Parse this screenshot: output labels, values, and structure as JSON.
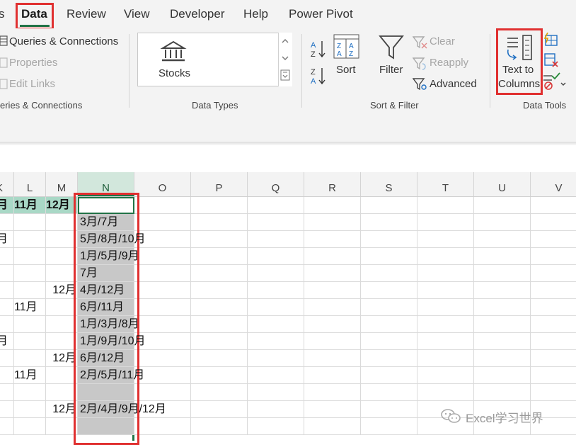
{
  "tabs": [
    "s",
    "Data",
    "Review",
    "View",
    "Developer",
    "Help",
    "Power Pivot"
  ],
  "queries": {
    "items": [
      "Queries & Connections",
      "Properties",
      "Edit Links"
    ],
    "group_label": "eries & Connections"
  },
  "data_types": {
    "stocks_label": "Stocks",
    "group_label": "Data Types"
  },
  "sort_filter": {
    "sort_label": "Sort",
    "filter_label": "Filter",
    "clear_label": "Clear",
    "reapply_label": "Reapply",
    "advanced_label": "Advanced",
    "group_label": "Sort & Filter"
  },
  "data_tools": {
    "text_to_columns_line1": "Text to",
    "text_to_columns_line2": "Columns",
    "group_label": "Data Tools"
  },
  "columns": [
    "K",
    "L",
    "M",
    "N",
    "O",
    "P",
    "Q",
    "R",
    "S",
    "T",
    "U",
    "V"
  ],
  "grid": {
    "header_row": {
      "K": "月",
      "L": "11月",
      "M": "12月",
      "N": ""
    },
    "rows": [
      {
        "K": "",
        "L": "",
        "M": "",
        "N": "3月/7月"
      },
      {
        "K": "月",
        "L": "",
        "M": "",
        "N": "5月/8月/10月"
      },
      {
        "K": "",
        "L": "",
        "M": "",
        "N": "1月/5月/9月"
      },
      {
        "K": "",
        "L": "",
        "M": "",
        "N": "7月"
      },
      {
        "K": "",
        "L": "",
        "M": "12月",
        "N": "4月/12月"
      },
      {
        "K": "",
        "L": "11月",
        "M": "",
        "N": "6月/11月"
      },
      {
        "K": "",
        "L": "",
        "M": "",
        "N": "1月/3月/8月"
      },
      {
        "K": "月",
        "L": "",
        "M": "",
        "N": "1月/9月/10月"
      },
      {
        "K": "",
        "L": "",
        "M": "12月",
        "N": "6月/12月"
      },
      {
        "K": "",
        "L": "11月",
        "M": "",
        "N": "2月/5月/11月"
      },
      {
        "K": "",
        "L": "",
        "M": "",
        "N": ""
      },
      {
        "K": "",
        "L": "",
        "M": "12月",
        "N": "2月/4月/9月/12月"
      },
      {
        "K": "",
        "L": "",
        "M": "",
        "N": ""
      }
    ]
  },
  "watermark": "Excel学习世界",
  "colors": {
    "accent_green": "#217346",
    "highlight_red": "#e03030",
    "header_fill": "#a9d8c6",
    "selection_fill": "#c8c8c8"
  }
}
